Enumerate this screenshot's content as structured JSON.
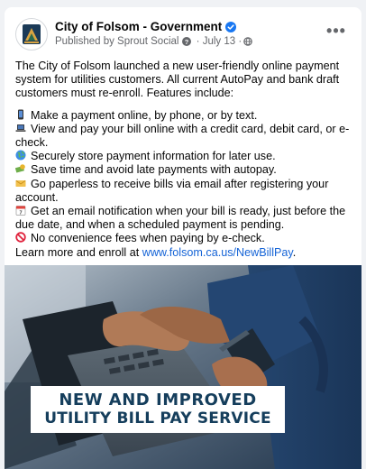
{
  "post": {
    "page_name": "City of Folsom - Government",
    "published_by": "Published by Sprout Social",
    "date": "July 13",
    "more_label": "•••",
    "intro": "The City of Folsom launched a new user-friendly online payment system for utilities customers. All current AutoPay and bank draft customers must re-enroll. Features include:",
    "features": [
      {
        "icon": "mobile-phone-icon",
        "text": "Make a payment online, by phone, or by text."
      },
      {
        "icon": "laptop-icon",
        "text": "View and pay your bill online with a credit card, debit card, or e-check."
      },
      {
        "icon": "globe-icon",
        "text": "Securely store payment information for later use."
      },
      {
        "icon": "money-icon",
        "text": "Save time and avoid late payments with autopay."
      },
      {
        "icon": "envelope-icon",
        "text": "Go paperless to receive bills via email after registering your account."
      },
      {
        "icon": "calendar-icon",
        "text": "Get an email notification when your bill is ready, just before the due date, and when a scheduled payment is pending."
      },
      {
        "icon": "no-entry-icon",
        "text": "No convenience fees when paying by e-check."
      }
    ],
    "learn_more": "Learn more and enroll at ",
    "link_text": "www.folsom.ca.us/NewBillPay",
    "link_suffix": "."
  },
  "image": {
    "banner_line1": "NEW AND IMPROVED",
    "banner_line2": "UTILITY BILL PAY SERVICE"
  },
  "colors": {
    "link": "#1463d6",
    "verified": "#1877f2",
    "banner_text": "#153e5c"
  }
}
